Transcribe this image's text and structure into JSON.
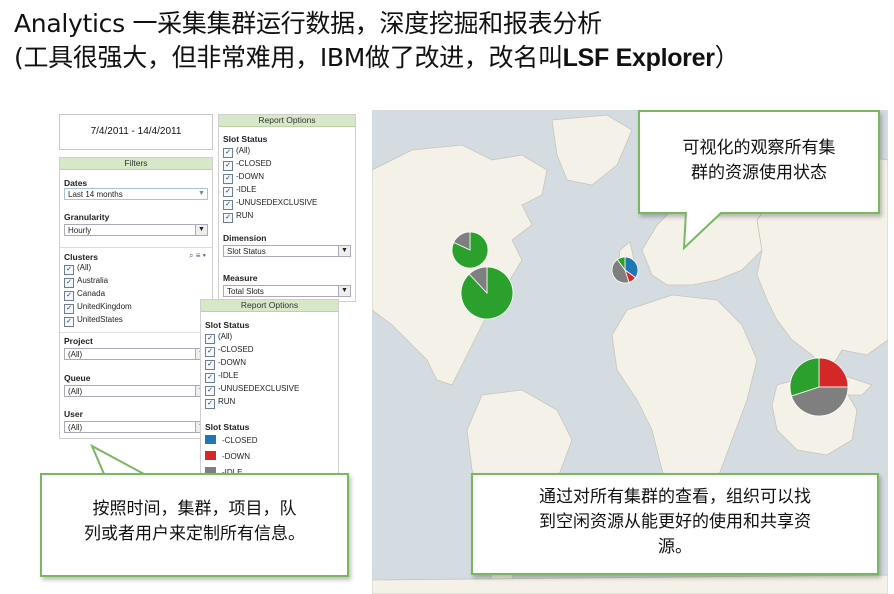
{
  "title": {
    "line1": "Analytics 一采集集群运行数据，深度挖掘和报表分析",
    "line2_pre": "(工具很强大，但非常难用，IBM做了改进，改名叫",
    "line2_bold": "LSF Explorer",
    "line2_post": "）"
  },
  "date_range": "7/4/2011 - 14/4/2011",
  "filters": {
    "header": "Filters",
    "dates_label": "Dates",
    "dates_value": "Last 14 months",
    "granularity_label": "Granularity",
    "granularity_value": "Hourly",
    "clusters_label": "Clusters",
    "clusters": [
      "(All)",
      "Australia",
      "Canada",
      "UnitedKingdom",
      "UnitedStates"
    ],
    "project_label": "Project",
    "project_value": "(All)",
    "queue_label": "Queue",
    "queue_value": "(All)",
    "user_label": "User",
    "user_value": "(All)"
  },
  "report_options_top": {
    "header": "Report Options",
    "slot_status_label": "Slot Status",
    "slot_statuses": [
      "(All)",
      "-CLOSED",
      "-DOWN",
      "-IDLE",
      "-UNUSEDEXCLUSIVE",
      "RUN"
    ],
    "dimension_label": "Dimension",
    "dimension_value": "Slot Status",
    "measure_label": "Measure",
    "measure_value": "Total Slots"
  },
  "report_options_bottom": {
    "header": "Report Options",
    "slot_status_label": "Slot Status",
    "slot_statuses": [
      "(All)",
      "-CLOSED",
      "-DOWN",
      "-IDLE",
      "-UNUSEDEXCLUSIVE",
      "RUN"
    ],
    "legend_label": "Slot Status",
    "legend": [
      {
        "label": "-CLOSED",
        "color": "#1f77b4"
      },
      {
        "label": "-DOWN",
        "color": "#d62728"
      },
      {
        "label": "-IDLE",
        "color": "#7f7f7f"
      }
    ]
  },
  "colors": {
    "run": "#2ca02c",
    "down": "#d62728",
    "idle": "#7f7f7f",
    "closed": "#1f77b4",
    "accent_green": "#78b860",
    "header_green": "#d6e8c8"
  },
  "callouts": {
    "map_top": [
      "可视化的观察所有集",
      "群的资源使用状态"
    ],
    "left_bottom": [
      "按照时间，集群，项目，队",
      "列或者用户来定制所有信息。"
    ],
    "right_bottom": [
      "通过对所有集群的查看，组织可以找",
      "到空闲资源从能更好的使用和共享资",
      "源。"
    ]
  }
}
